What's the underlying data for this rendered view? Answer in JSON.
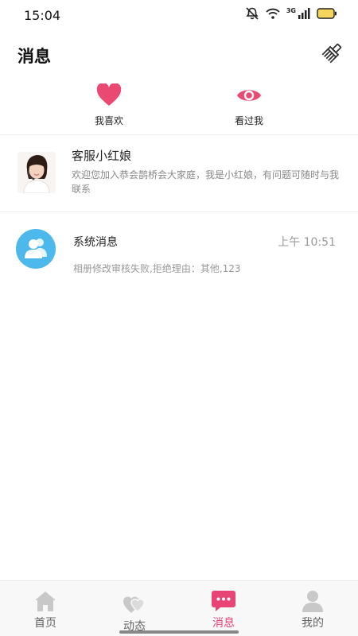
{
  "status_bar": {
    "time": "15:04",
    "network": "3G",
    "icons": [
      "mute-icon",
      "wifi-icon",
      "signal-icon",
      "battery-icon"
    ]
  },
  "header": {
    "title": "消息",
    "clear_icon": "broom-icon"
  },
  "quick_tabs": [
    {
      "label": "我喜欢",
      "icon": "heart-icon"
    },
    {
      "label": "看过我",
      "icon": "eye-icon"
    }
  ],
  "messages": [
    {
      "name": "客服小红娘",
      "preview": "欢迎您加入恭会鹊桥会大家庭，我是小红娘，有问题可随时与我联系",
      "avatar": "customer-service-avatar"
    },
    {
      "name": "系统消息",
      "time": "上午 10:51",
      "preview": "相册修改审核失败,拒绝理由：其他,123",
      "avatar": "system-user-icon"
    }
  ],
  "tab_bar": [
    {
      "label": "首页",
      "icon": "home-icon"
    },
    {
      "label": "动态",
      "icon": "hearts-icon"
    },
    {
      "label": "消息",
      "icon": "chat-bubble-icon",
      "active": true
    },
    {
      "label": "我的",
      "icon": "person-icon"
    }
  ],
  "colors": {
    "accent": "#e94476",
    "system_avatar": "#4cb8ec",
    "inactive_icon": "#c8c8c8"
  }
}
